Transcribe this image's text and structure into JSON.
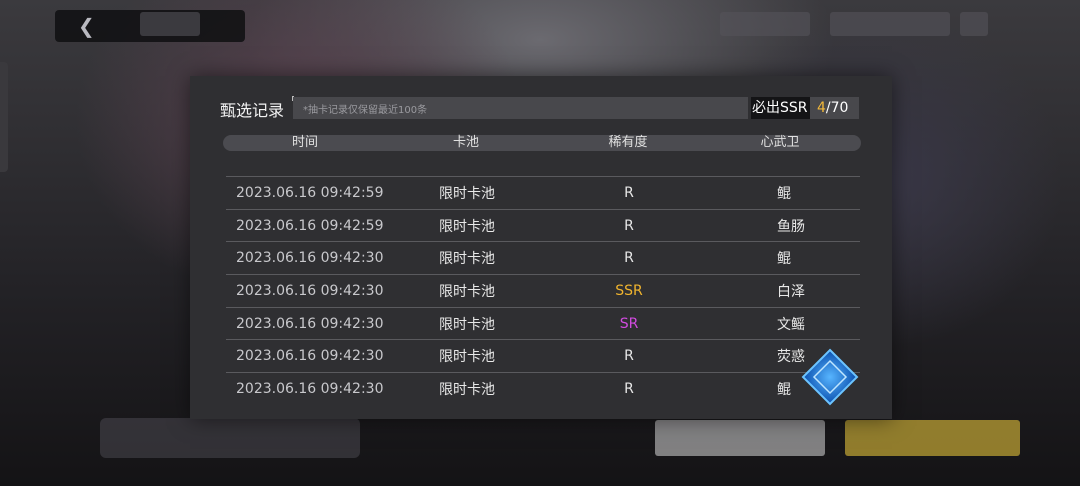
{
  "panel": {
    "title": "甄选记录",
    "notice": "*抽卡记录仅保留最近100条",
    "ssr_label": "必出SSR",
    "ssr_current": "4",
    "ssr_total": "/70"
  },
  "columns": [
    "时间",
    "卡池",
    "稀有度",
    "心武卫"
  ],
  "rows": [
    {
      "time": "2023.06.16  09:42:59",
      "pool": "限时卡池",
      "rarity": "R",
      "name": "鲲"
    },
    {
      "time": "2023.06.16  09:42:59",
      "pool": "限时卡池",
      "rarity": "R",
      "name": "鱼肠"
    },
    {
      "time": "2023.06.16  09:42:30",
      "pool": "限时卡池",
      "rarity": "R",
      "name": "鲲"
    },
    {
      "time": "2023.06.16  09:42:30",
      "pool": "限时卡池",
      "rarity": "SSR",
      "name": "白泽"
    },
    {
      "time": "2023.06.16  09:42:30",
      "pool": "限时卡池",
      "rarity": "SR",
      "name": "文鳐"
    },
    {
      "time": "2023.06.16  09:42:30",
      "pool": "限时卡池",
      "rarity": "R",
      "name": "荧惑"
    },
    {
      "time": "2023.06.16  09:42:30",
      "pool": "限时卡池",
      "rarity": "R",
      "name": "鲲"
    }
  ],
  "colors": {
    "ssr": "#f0b42e",
    "sr": "#d24be0",
    "accent": "#2a8cff"
  },
  "icons": {
    "back": "back-arrow-icon",
    "fab": "diamond-compass-icon"
  }
}
